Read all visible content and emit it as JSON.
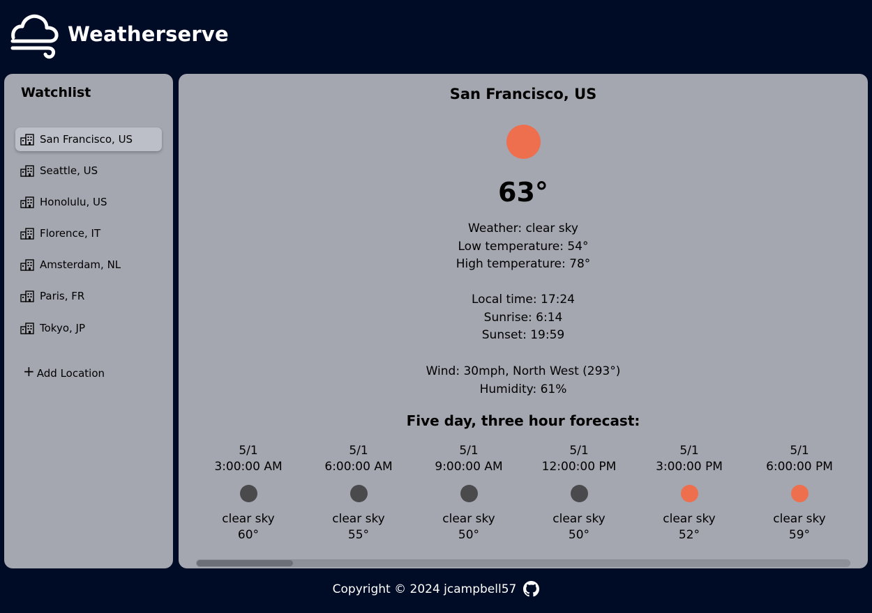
{
  "header": {
    "title": "Weatherserve",
    "logo_icon": "cloud-wind-icon"
  },
  "sidebar": {
    "title": "Watchlist",
    "items": [
      {
        "label": "San Francisco, US",
        "icon": "building-icon",
        "active": true
      },
      {
        "label": "Seattle, US",
        "icon": "building-icon"
      },
      {
        "label": "Honolulu, US",
        "icon": "building-icon"
      },
      {
        "label": "Florence, IT",
        "icon": "building-icon"
      },
      {
        "label": "Amsterdam, NL",
        "icon": "building-icon"
      },
      {
        "label": "Paris, FR",
        "icon": "building-icon"
      },
      {
        "label": "Tokyo, JP",
        "icon": "building-icon"
      }
    ],
    "add_symbol": "+",
    "add_label": "Add Location"
  },
  "main": {
    "city": "San Francisco, US",
    "icon_color": "#ee6f4e",
    "temperature": "63°",
    "weather": "Weather: clear sky",
    "low": "Low temperature: 54°",
    "high": "High temperature: 78°",
    "local_time": "Local time: 17:24",
    "sunrise": "Sunrise: 6:14",
    "sunset": "Sunset: 19:59",
    "wind": "Wind: 30mph, North West (293°)",
    "humidity": "Humidity: 61%",
    "forecast_title": "Five day, three hour forecast:",
    "forecast": [
      {
        "date": "5/1",
        "time": "3:00:00 AM",
        "desc": "clear sky",
        "temp": "60°",
        "icon_color": "#4a4a4c"
      },
      {
        "date": "5/1",
        "time": "6:00:00 AM",
        "desc": "clear sky",
        "temp": "55°",
        "icon_color": "#4a4a4c"
      },
      {
        "date": "5/1",
        "time": "9:00:00 AM",
        "desc": "clear sky",
        "temp": "50°",
        "icon_color": "#4a4a4c"
      },
      {
        "date": "5/1",
        "time": "12:00:00 PM",
        "desc": "clear sky",
        "temp": "50°",
        "icon_color": "#4a4a4c"
      },
      {
        "date": "5/1",
        "time": "3:00:00 PM",
        "desc": "clear sky",
        "temp": "52°",
        "icon_color": "#ee6f4e"
      },
      {
        "date": "5/1",
        "time": "6:00:00 PM",
        "desc": "clear sky",
        "temp": "59°",
        "icon_color": "#ee6f4e"
      }
    ],
    "scroll_position": 0.0
  },
  "footer": {
    "text": "Copyright © 2024 jcampbell57",
    "icon": "github-icon"
  }
}
